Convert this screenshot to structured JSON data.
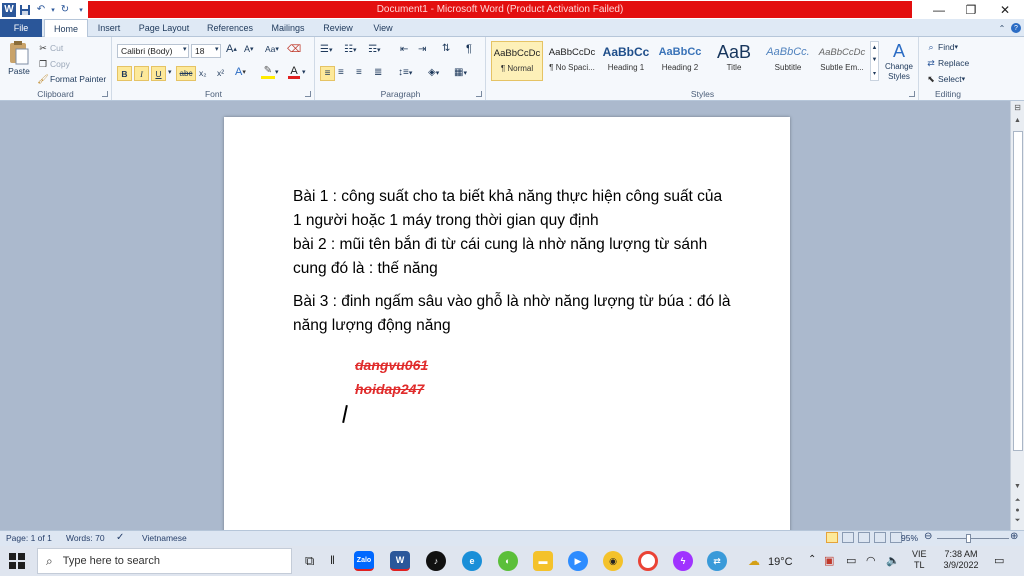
{
  "window": {
    "title": "Document1 - Microsoft Word (Product Activation Failed)",
    "word_logo": "W"
  },
  "tabs": [
    {
      "label": "File"
    },
    {
      "label": "Home"
    },
    {
      "label": "Insert"
    },
    {
      "label": "Page Layout"
    },
    {
      "label": "References"
    },
    {
      "label": "Mailings"
    },
    {
      "label": "Review"
    },
    {
      "label": "View"
    }
  ],
  "ribbon": {
    "clipboard": {
      "label": "Clipboard",
      "paste": "Paste",
      "cut": "Cut",
      "copy": "Copy",
      "format_painter": "Format Painter"
    },
    "font": {
      "label": "Font",
      "font_name": "Calibri (Body)",
      "font_size": "18",
      "bold": "B",
      "italic": "I",
      "underline": "U",
      "strike": "abc",
      "grow": "A",
      "shrink": "A",
      "case": "Aa",
      "sub": "x₂",
      "sup": "x²",
      "highlight_letter": "A",
      "color_letter": "A"
    },
    "paragraph": {
      "label": "Paragraph",
      "pilcrow": "¶"
    },
    "styles": {
      "label": "Styles",
      "items": [
        {
          "preview": "AaBbCcDc",
          "name": "¶ Normal"
        },
        {
          "preview": "AaBbCcDc",
          "name": "¶ No Spaci..."
        },
        {
          "preview": "AaBbCc",
          "name": "Heading 1"
        },
        {
          "preview": "AaBbCc",
          "name": "Heading 2"
        },
        {
          "preview": "AaB",
          "name": "Title"
        },
        {
          "preview": "AaBbCc.",
          "name": "Subtitle"
        },
        {
          "preview": "AaBbCcDc",
          "name": "Subtle Em..."
        }
      ],
      "change_styles": "Change Styles"
    },
    "editing": {
      "label": "Editing",
      "find": "Find",
      "replace": "Replace",
      "select": "Select"
    }
  },
  "document": {
    "paragraphs": [
      "Bài 1 : công suất cho ta biết khả năng thực hiện công suất của 1 người hoặc 1 máy trong thời gian quy định",
      "bài 2 : mũi tên bắn đi từ cái cung là nhờ năng lượng từ sánh cung đó là : thế năng",
      "Bài 3 : đinh ngấm sâu vào ghỗ là nhờ năng lượng từ búa : đó là năng lượng động năng"
    ],
    "watermark_lines": [
      "dangvu061",
      "hoidap247"
    ]
  },
  "statusbar": {
    "page": "Page: 1 of 1",
    "words": "Words: 70",
    "language": "Vietnamese",
    "zoom": "95%"
  },
  "taskbar": {
    "search_placeholder": "Type here to search",
    "weather": "19°C",
    "lang_top": "VIE",
    "lang_bottom": "TL",
    "time": "7:38 AM",
    "date": "3/9/2022",
    "apps": [
      "Zalo",
      "W"
    ]
  }
}
